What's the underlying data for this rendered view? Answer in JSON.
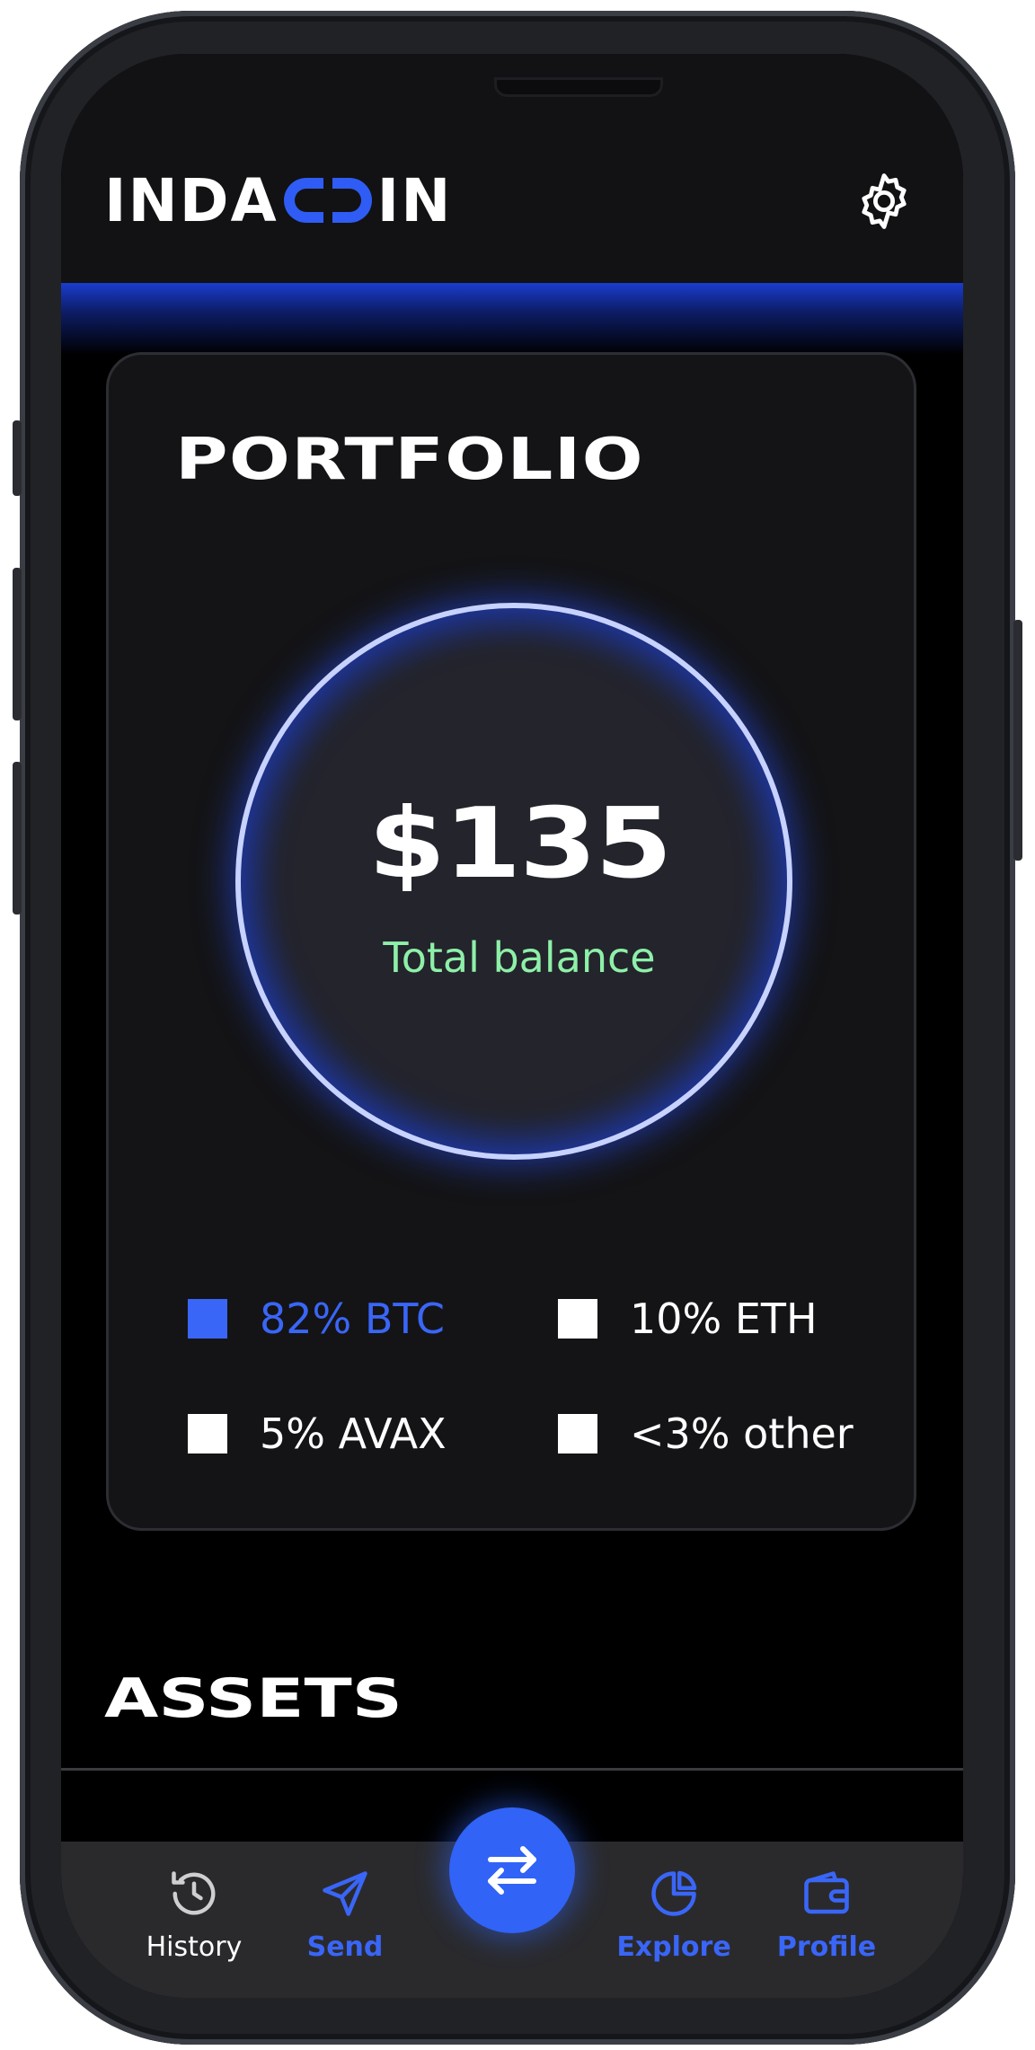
{
  "app": {
    "logo_text": "INDACOIN",
    "logo_pre": "INDA",
    "logo_post": "IN"
  },
  "portfolio": {
    "title": "PORTFOLIO",
    "amount": "$135",
    "amount_label": "Total balance",
    "legend": [
      {
        "label": "82% BTC",
        "color": "#3a66f7"
      },
      {
        "label": "10% ETH",
        "color": "#ffffff"
      },
      {
        "label": "5% AVAX",
        "color": "#ffffff"
      },
      {
        "label": "<3% other",
        "color": "#ffffff"
      }
    ]
  },
  "assets": {
    "title": "ASSETS"
  },
  "nav": {
    "items": [
      {
        "label": "History",
        "icon": "history-icon"
      },
      {
        "label": "Send",
        "icon": "send-icon"
      },
      {
        "label": "",
        "icon": "swap-icon"
      },
      {
        "label": "Explore",
        "icon": "pie-chart-icon"
      },
      {
        "label": "Profile",
        "icon": "wallet-icon"
      }
    ]
  },
  "colors": {
    "accent": "#3163f6",
    "balance_label": "#8ef0a8",
    "background": "#000000"
  }
}
